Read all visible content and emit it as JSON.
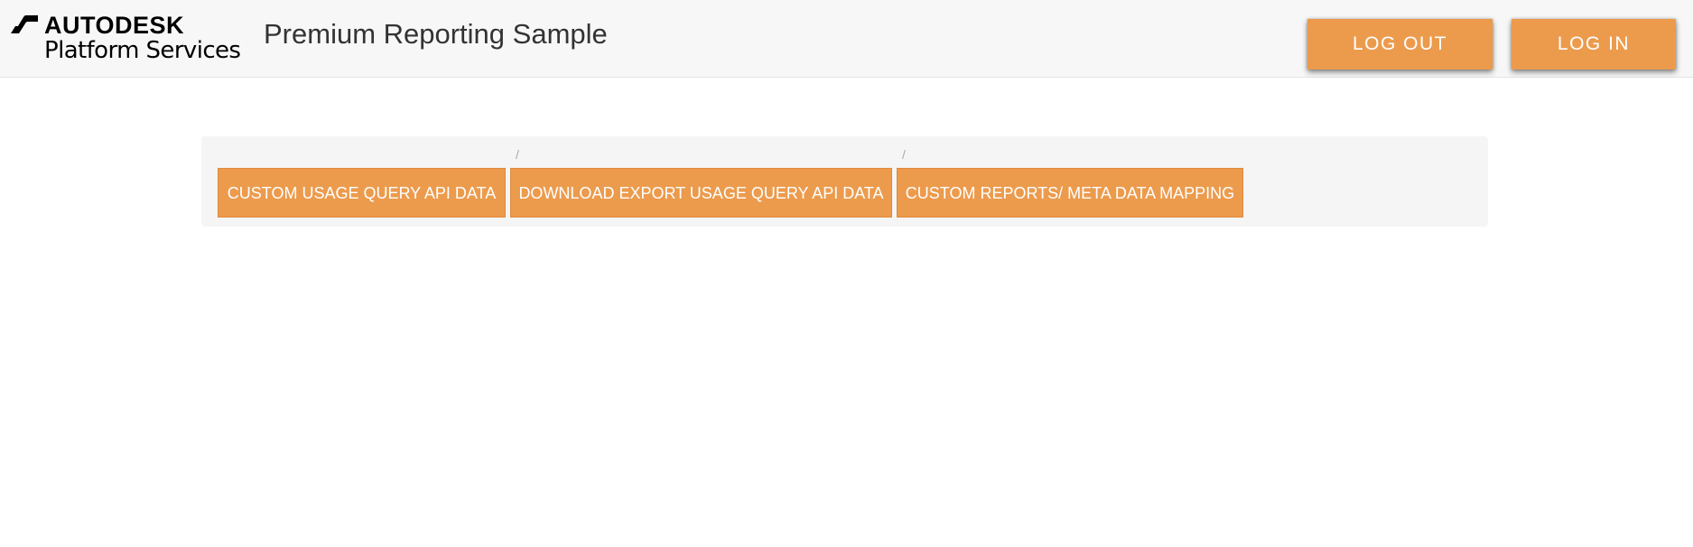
{
  "navbar": {
    "logo": {
      "brand": "AUTODESK",
      "product": "Platform Services"
    },
    "title": "Premium Reporting Sample",
    "logout_label": "LOG OUT",
    "login_label": "LOG IN"
  },
  "breadcrumb": {
    "separator": "/",
    "items": [
      {
        "label": "CUSTOM USAGE QUERY API DATA"
      },
      {
        "label": "DOWNLOAD EXPORT USAGE QUERY API DATA"
      },
      {
        "label": "CUSTOM REPORTS/ META DATA MAPPING"
      }
    ]
  },
  "colors": {
    "accent": "#ec9b4d",
    "navbar_bg": "#f7f7f7",
    "panel_bg": "#f5f5f5",
    "title_text": "#333333"
  }
}
